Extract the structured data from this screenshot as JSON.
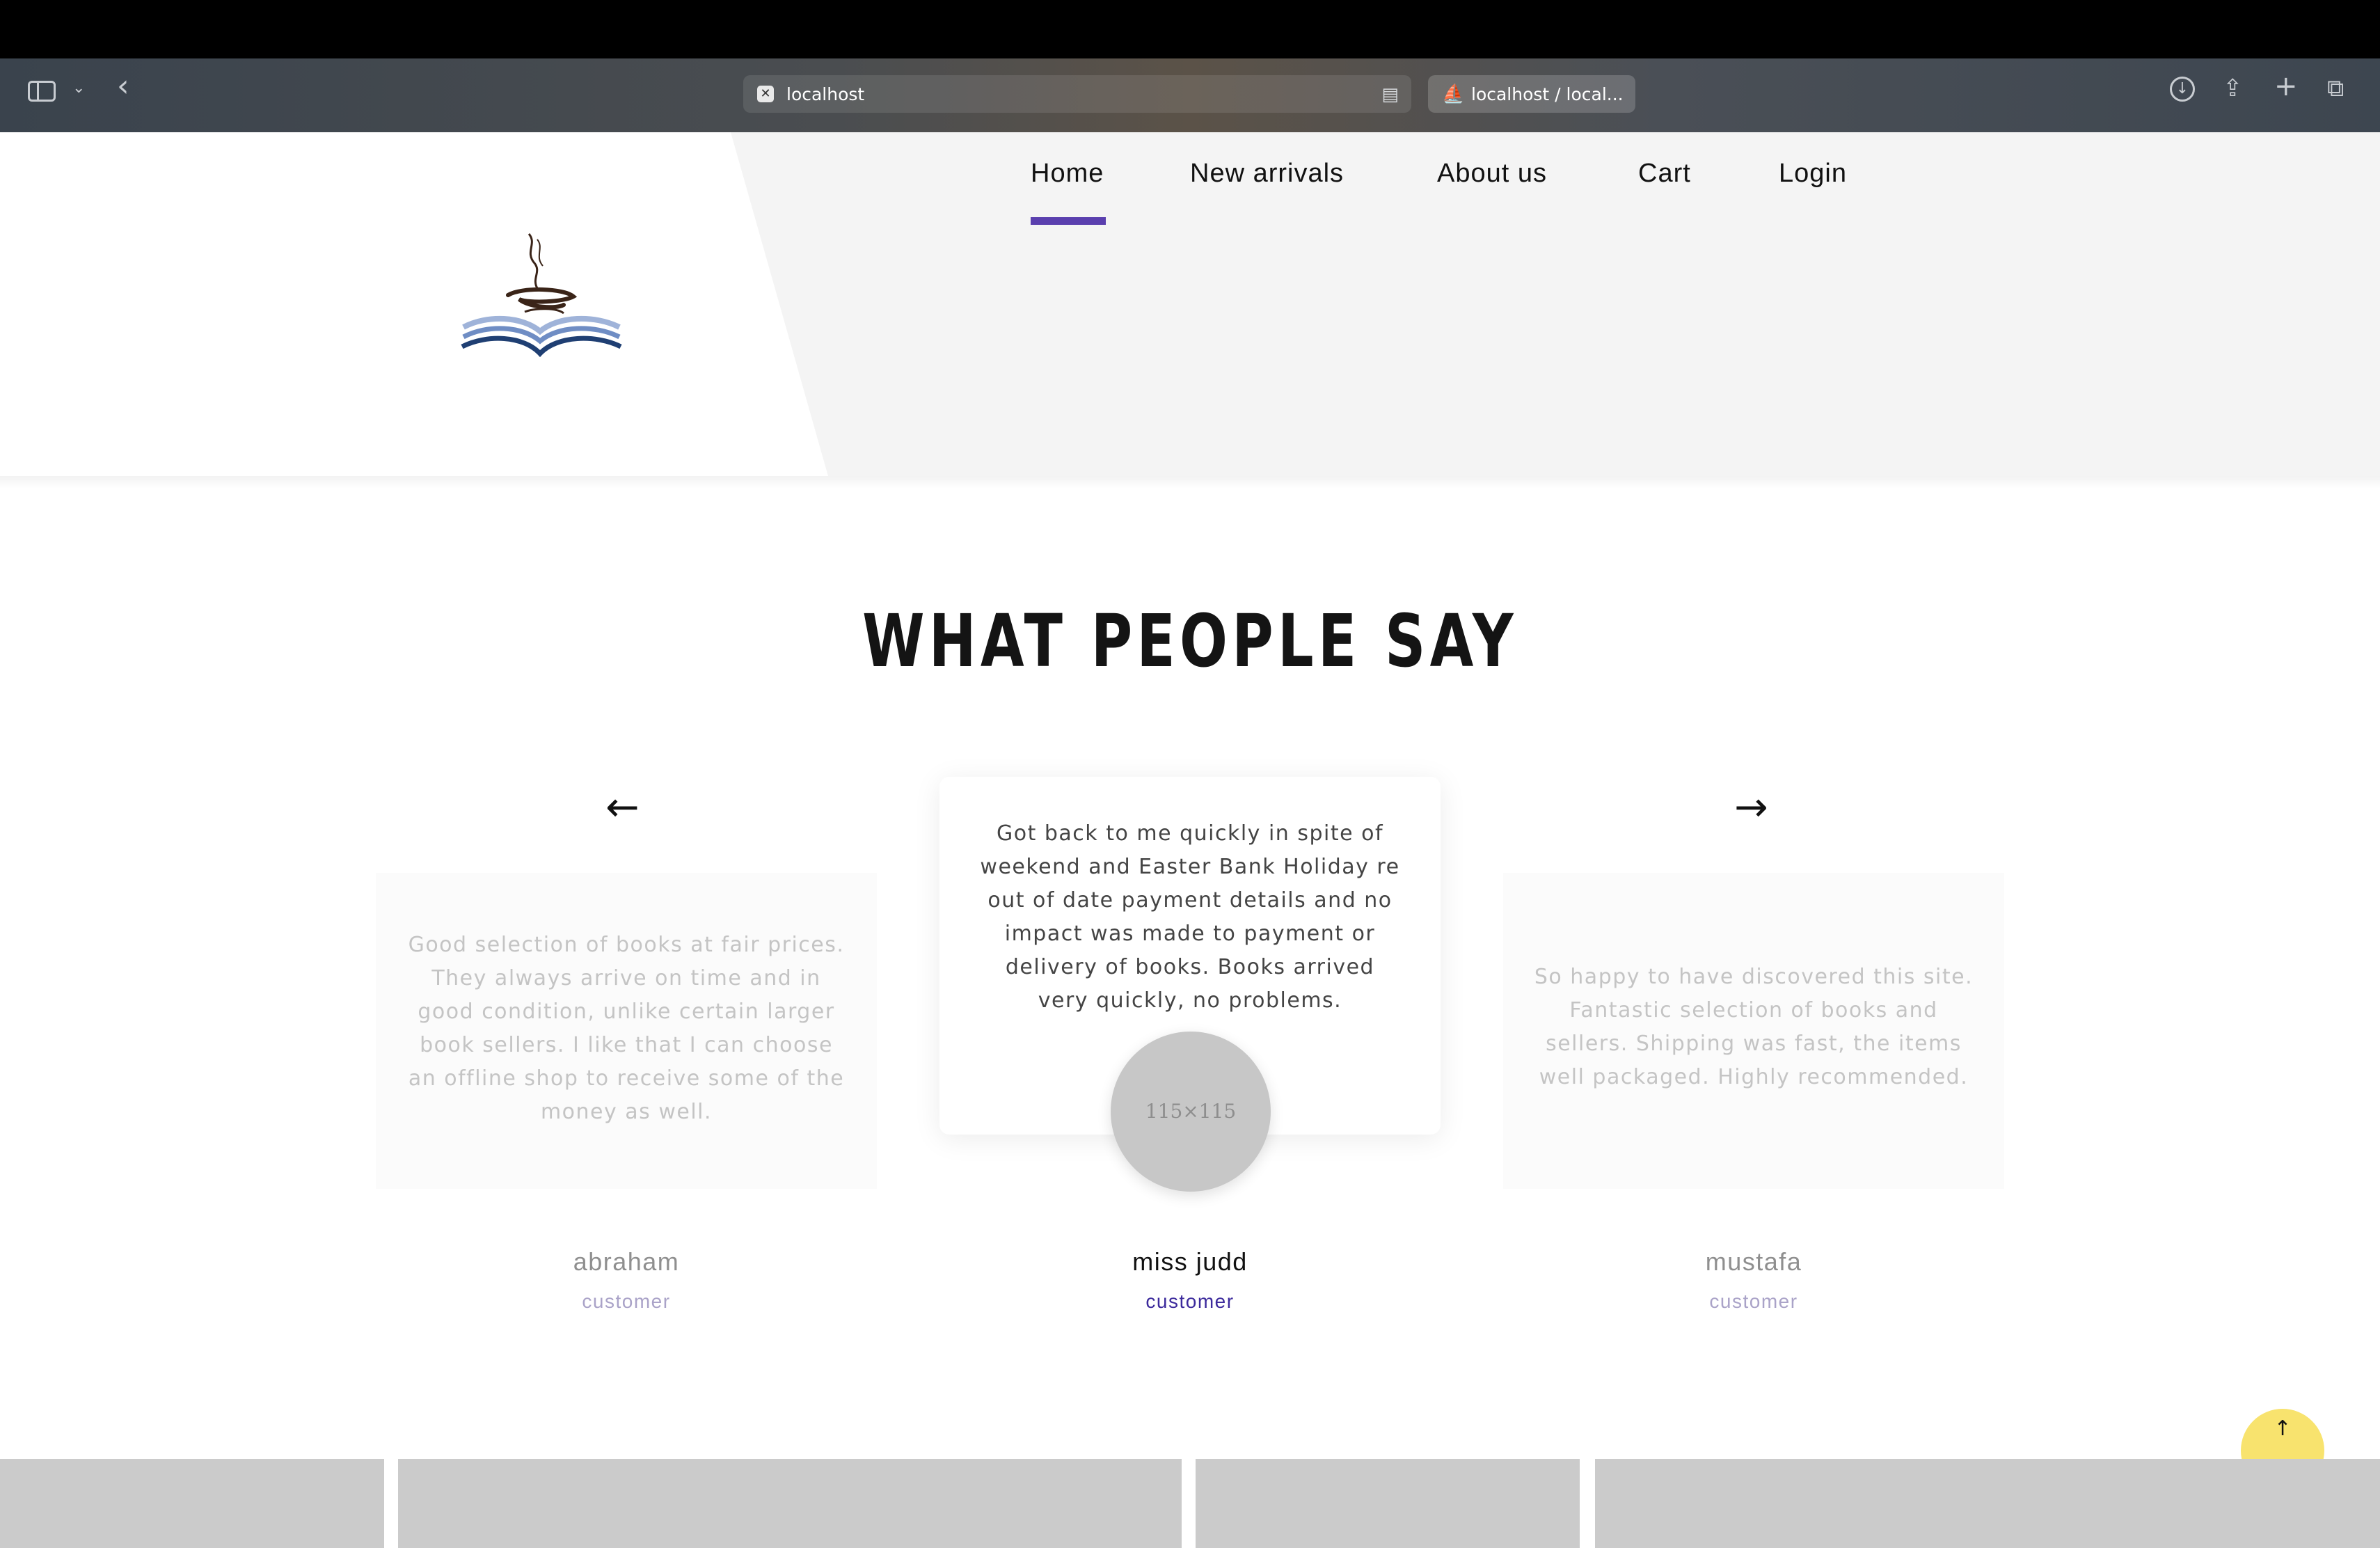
{
  "browser": {
    "url_text": "localhost",
    "tab2_title": "localhost / local..."
  },
  "nav": {
    "items": [
      "Home",
      "New arrivals",
      "About us",
      "Cart",
      "Login"
    ],
    "active": "Home",
    "accent_color": "#5a3fae"
  },
  "testimonials": {
    "title": "WHAT PEOPLE SAY",
    "cards": [
      {
        "text": "Good selection of books at fair prices. They always arrive on time and in good condition, unlike certain larger book sellers. I like that I can choose an offline shop to receive some of the money as well.",
        "name": "abraham",
        "role": "customer"
      },
      {
        "text": "Got back to me quickly in spite of weekend and Easter Bank Holiday re out of date payment details and no impact was made to payment or delivery of books. Books arrived very quickly, no problems.",
        "name": "miss judd",
        "role": "customer",
        "avatar_placeholder": "115×115"
      },
      {
        "text": "So happy to have discovered this site. Fantastic selection of books and sellers. Shipping was fast, the items well packaged. Highly recommended.",
        "name": "mustafa",
        "role": "customer"
      }
    ]
  },
  "back_to_top": {
    "color": "#f8e36e"
  }
}
